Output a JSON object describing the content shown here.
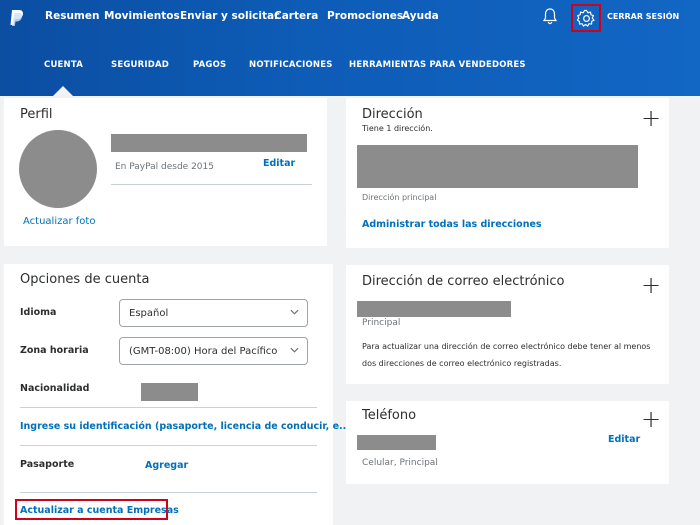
{
  "nav": {
    "items": [
      "Resumen",
      "Movimientos",
      "Enviar y solicitar",
      "Cartera",
      "Promociones",
      "Ayuda"
    ],
    "logout": "CERRAR SESIÓN",
    "logo_icon": "paypal-logo",
    "bell_icon": "bell-icon",
    "gear_icon": "gear-icon"
  },
  "subnav": {
    "tabs": [
      "CUENTA",
      "SEGURIDAD",
      "PAGOS",
      "NOTIFICACIONES",
      "HERRAMIENTAS PARA VENDEDORES"
    ],
    "active": "CUENTA"
  },
  "profile": {
    "title": "Perfil",
    "member_since": "En PayPal desde 2015",
    "edit": "Editar",
    "update_photo": "Actualizar foto"
  },
  "account_options": {
    "title": "Opciones de cuenta",
    "language_label": "Idioma",
    "language_value": "Español",
    "timezone_label": "Zona horaria",
    "timezone_value": "(GMT-08:00) Hora del Pacífico",
    "nationality_label": "Nacionalidad",
    "id_prompt": "Ingrese su identificación (pasaporte, licencia de conducir, e...",
    "passport_label": "Pasaporte",
    "passport_add": "Agregar",
    "upgrade_link": "Actualizar a cuenta Empresas"
  },
  "address": {
    "title": "Dirección",
    "count": "Tiene 1 dirección.",
    "primary": "Dirección principal",
    "manage": "Administrar todas las direcciones"
  },
  "email": {
    "title": "Dirección de correo electrónico",
    "primary": "Principal",
    "note": "Para actualizar una dirección de correo electrónico debe tener al menos dos direcciones de correo electrónico registradas."
  },
  "phone": {
    "title": "Teléfono",
    "edit": "Editar",
    "type": "Celular, Principal"
  },
  "colors": {
    "nav_bg": "#0d5bb5",
    "link": "#0070ba",
    "highlight": "#d0021b",
    "redacted": "#8c8c8c"
  }
}
